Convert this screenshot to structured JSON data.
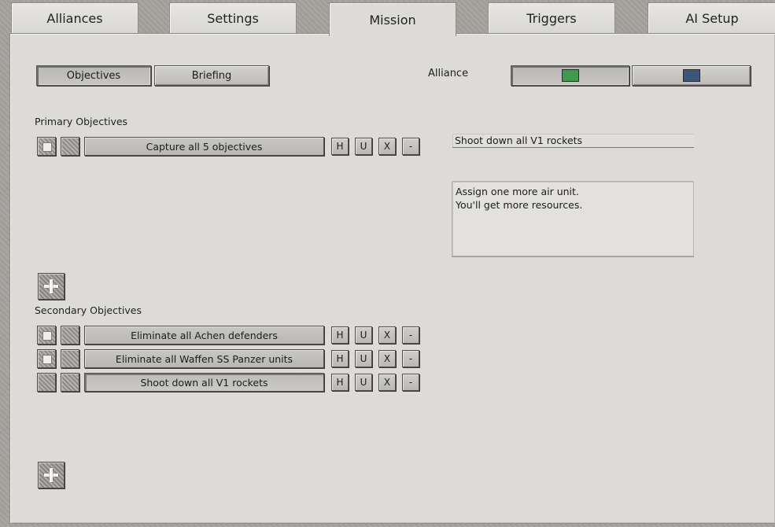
{
  "tabs": [
    {
      "label": "Alliances",
      "active": false
    },
    {
      "label": "Settings",
      "active": false
    },
    {
      "label": "Mission",
      "active": true
    },
    {
      "label": "Triggers",
      "active": false
    },
    {
      "label": "AI Setup",
      "active": false
    }
  ],
  "subtabs": {
    "objectives": "Objectives",
    "briefing": "Briefing",
    "active": "objectives"
  },
  "alliance": {
    "label": "Alliance",
    "options": [
      {
        "color": "#3f9a4c",
        "selected": true
      },
      {
        "color": "#3d5778",
        "selected": false
      }
    ]
  },
  "primary": {
    "heading": "Primary Objectives",
    "items": [
      {
        "text": "Capture all 5 objectives",
        "checked": true,
        "selected": false
      }
    ]
  },
  "secondary": {
    "heading": "Secondary Objectives",
    "items": [
      {
        "text": "Eliminate all Achen defenders",
        "checked": true,
        "selected": false
      },
      {
        "text": "Eliminate all Waffen SS Panzer units",
        "checked": true,
        "selected": false
      },
      {
        "text": "Shoot down all V1 rockets",
        "checked": false,
        "selected": true
      }
    ]
  },
  "row_buttons": {
    "h": "H",
    "u": "U",
    "x": "X",
    "minus": "-"
  },
  "detail": {
    "title": "Shoot down all V1 rockets",
    "description_line1": "Assign one more air unit.",
    "description_line2": "You'll get more resources."
  },
  "icons": {
    "add": "plus-icon"
  }
}
